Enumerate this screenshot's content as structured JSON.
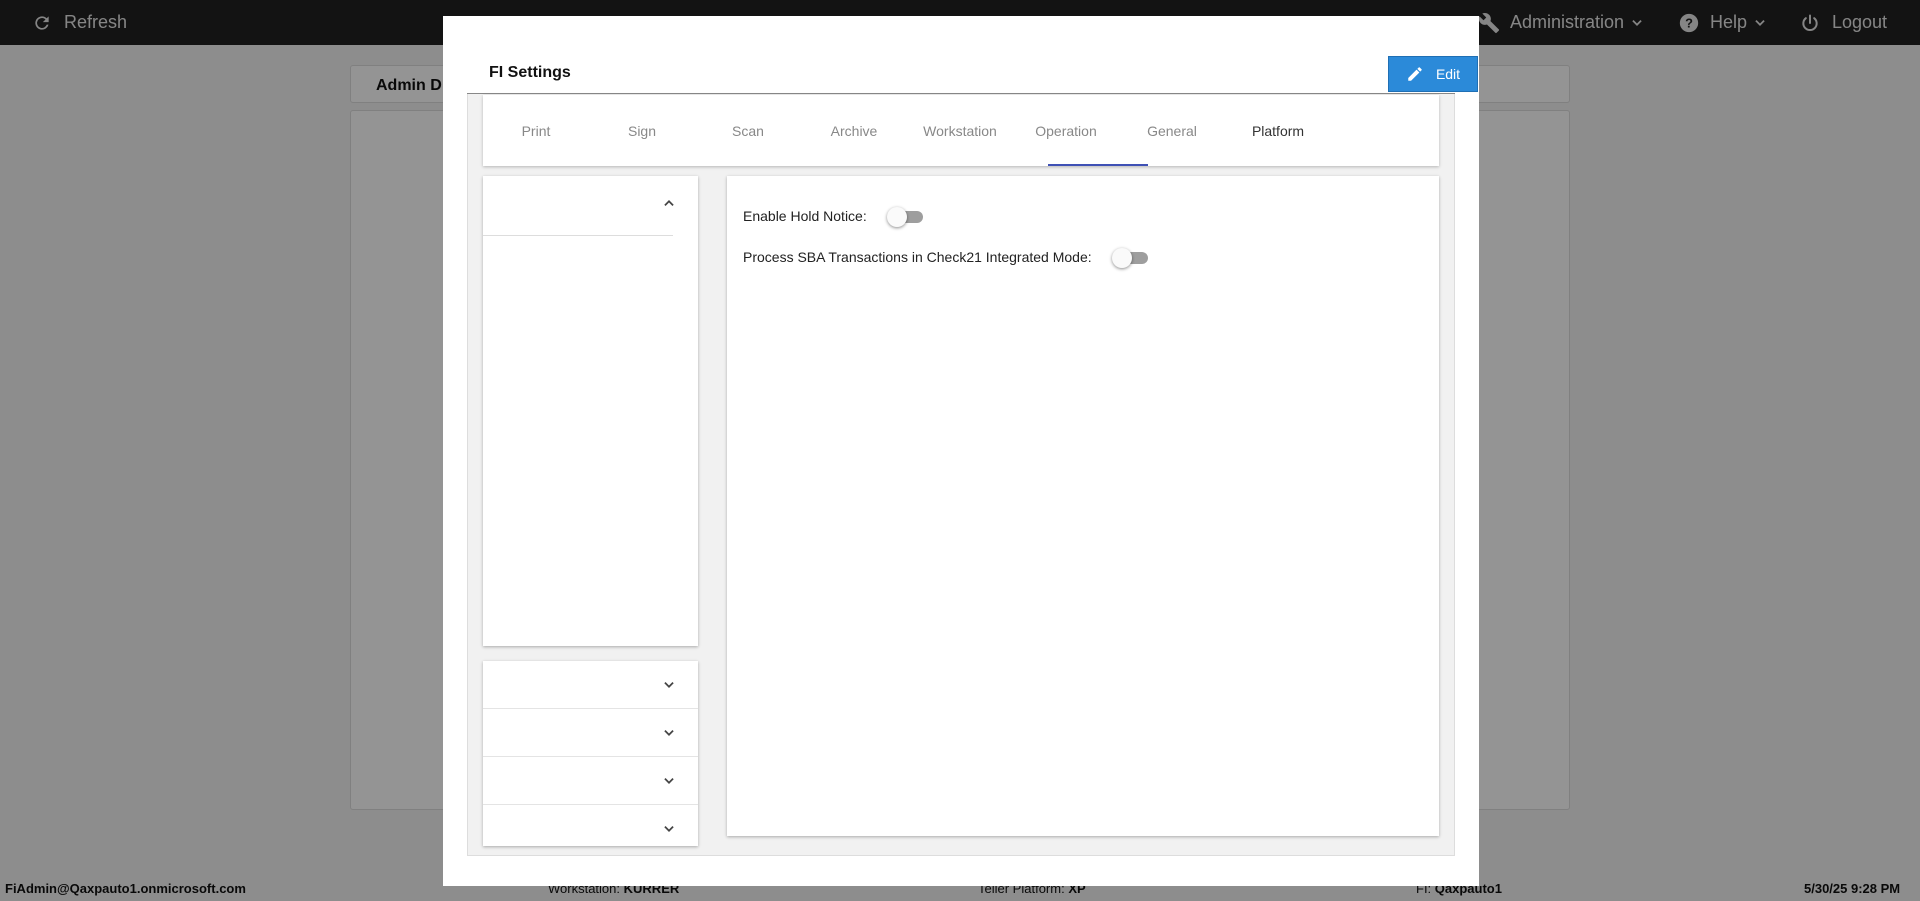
{
  "topbar": {
    "refresh_label": "Refresh",
    "administration_label": "Administration",
    "help_label": "Help",
    "logout_label": "Logout"
  },
  "background_page": {
    "header_title": "Admin D"
  },
  "statusbar": {
    "user": "FiAdmin@Qaxpauto1.onmicrosoft.com",
    "workstation_label": "Workstation:",
    "workstation_value": "KURRER",
    "teller_platform_label": "Teller Platform:",
    "teller_platform_value": "XP",
    "fi_label": "FI:",
    "fi_value": "Qaxpauto1",
    "timestamp": "5/30/25 9:28 PM"
  },
  "modal": {
    "title": "FI Settings",
    "edit_label": "Edit",
    "tabs": [
      {
        "label": "Print"
      },
      {
        "label": "Sign"
      },
      {
        "label": "Scan"
      },
      {
        "label": "Archive"
      },
      {
        "label": "Workstation"
      },
      {
        "label": "Operation"
      },
      {
        "label": "General"
      },
      {
        "label": "Platform"
      }
    ],
    "active_tab": "Operation",
    "settings": [
      {
        "label": "Enable Hold Notice:",
        "enabled": false
      },
      {
        "label": "Process SBA Transactions in Check21 Integrated Mode:",
        "enabled": false
      }
    ]
  },
  "colors": {
    "topbar_bg": "#222222",
    "edit_button_bg": "#2b8ad9",
    "active_tab_indicator": "#3f51b5",
    "toggle_off_track": "#9e9e9e"
  }
}
